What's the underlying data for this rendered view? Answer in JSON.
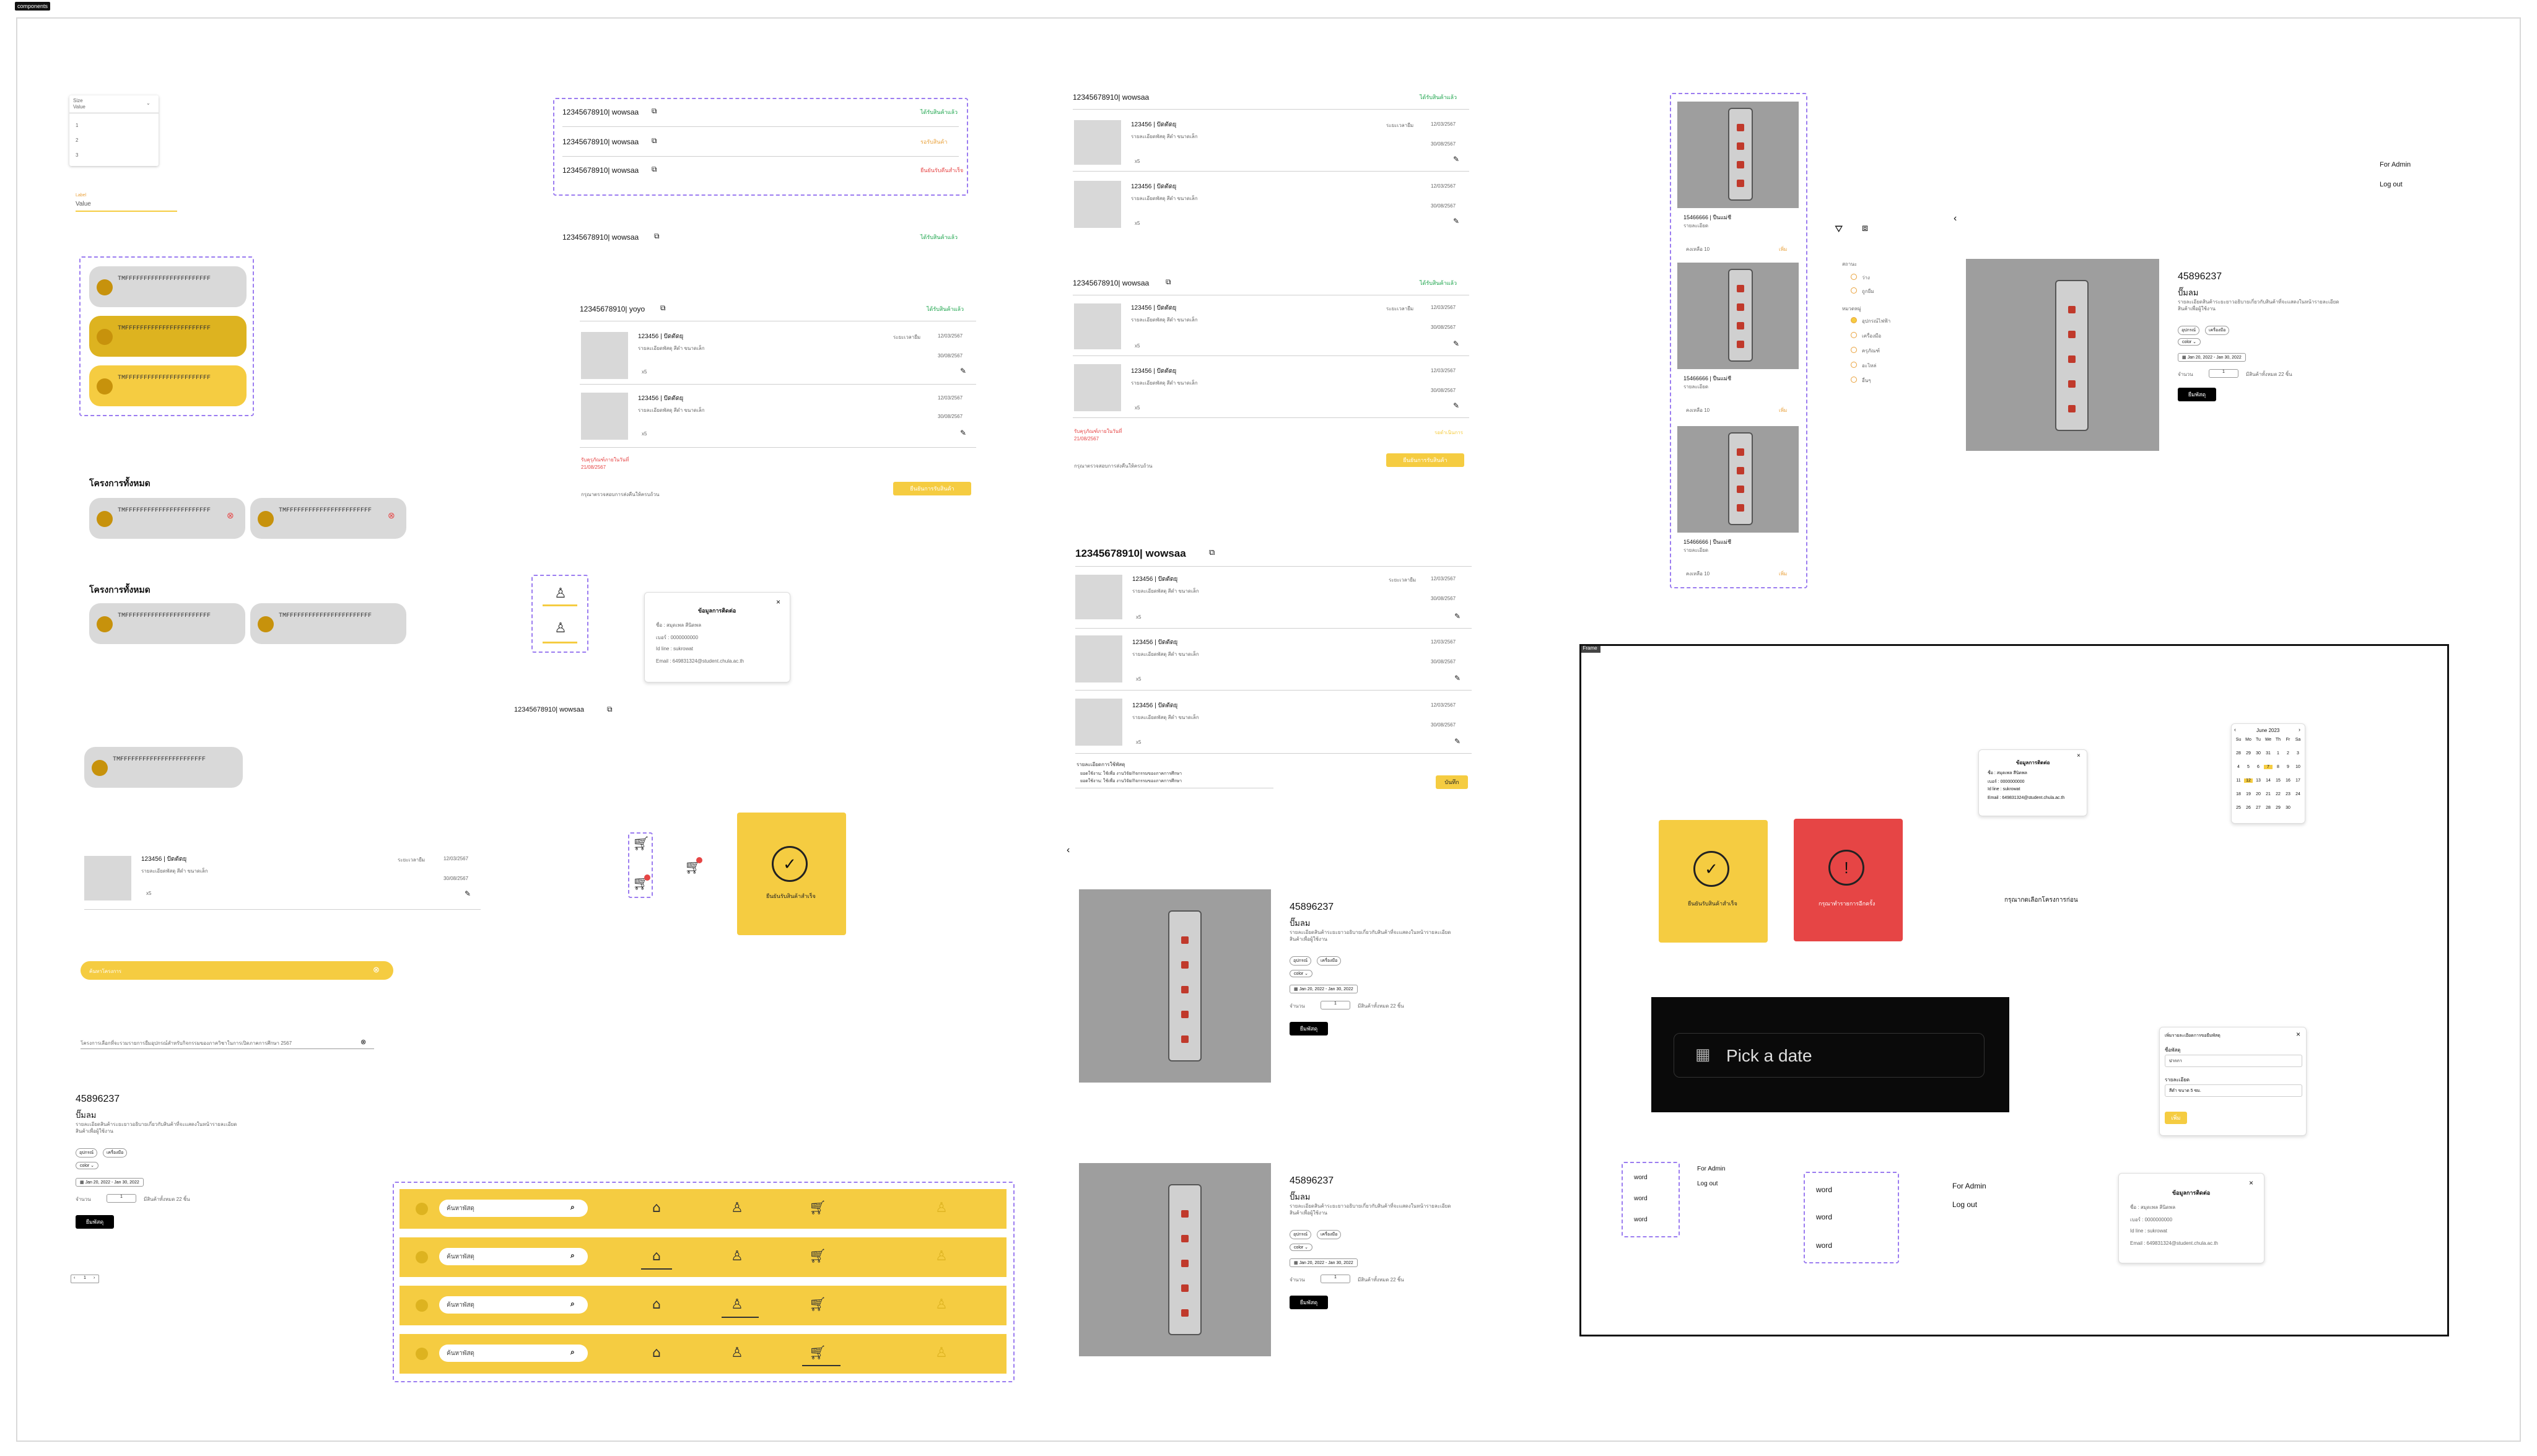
{
  "page": {
    "frame_label": "components",
    "dialog_label": "Frame"
  },
  "dropdown": {
    "label": "Size",
    "selected": "Value",
    "caret": "⌄",
    "options": [
      "1",
      "2",
      "3"
    ]
  },
  "textfield": {
    "label": "Label",
    "value": "Value"
  },
  "pills": {
    "text": "TMFFFFFFFFFFFFFFFFFFFFFFF"
  },
  "section_titles": {
    "all_rooms_1": "โครงการทั้งหมด",
    "all_rooms_2": "โครงการทั้งหมด"
  },
  "orders": {
    "id": "12345678910",
    "user": "wowsaa",
    "user2": "yoyo",
    "status_ready": "ได้รับสินค้าแล้ว",
    "status_waiting": "รอรับสินค้า",
    "status_overdue": "ยืนยันรับคืนสำเร็จ",
    "item_code": "123456 | ปัดตัดยุ",
    "item_desc": "รายละเอียดพัสดุ สีดำ ขนาดเล็ก",
    "borrow_label": "ระยะเวลายืม",
    "date_from": "12/03/2567",
    "date_to": "30/08/2567",
    "qty": "x5",
    "overdue_label": "รับคุรุภัณฑ์ภายในวันที่",
    "overdue_date": "21/08/2567",
    "note": "กรุณาตรวจสอบการส่งคืนให้ครบถ้วน",
    "confirm_btn": "ยืนยันการรับสินค้า",
    "save_btn": "บันทึก",
    "remark_label": "รายละเอียดการใช้พัสดุ",
    "remark_lines": [
      "ยอดใช้งาน: ใช้เพื่อ งานวิจัย/กิจกรรมของภาคการศึกษา",
      "ยอดใช้งาน: ใช้เพื่อ งานวิจัย/กิจกรรมของภาคการศึกษา"
    ],
    "wait_text": "รอดำเนินการ"
  },
  "user_card": {
    "title": "ข้อมูลการติดต่อ",
    "name": "ชื่อ : สมุดเพล สีนิดพล",
    "phone": "เบอร์ : 0000000000",
    "line": "Id line : sukrowat",
    "email": "Email : 649831324@student.chula.ac.th",
    "close": "×"
  },
  "success": {
    "label": "ยืนยันรับสินค้าสำเร็จ"
  },
  "error": {
    "label": "กรุณาทำรายการอีกครั้ง"
  },
  "empty_msg": "กรุณากดเลือกโครงการก่อน",
  "search_pill": {
    "placeholder": "ค้นหาโครงการ"
  },
  "announcement": "โครงการเลือกที่จะรวมรายการยืมอุปกรณ์สำหรับกิจกรรมของภาควิชาในการเปิดภาคการศึกษา 2567",
  "product": {
    "code": "45896237",
    "name": "ปั๊มลม",
    "desc": "รายละเอียดสินค้าระยะยาวอธิบายเกี่ยวกับสินค้าที่จะแสดงในหน้ารายละเอียดสินค้าเพื่อผู้ใช้งาน",
    "tags": [
      "อุปกรณ์",
      "เครื่องมือ"
    ],
    "color": "color ⌄",
    "daterange": "Jan 20, 2022 - Jan 30, 2022",
    "qty_label": "จำนวน",
    "qty": "1",
    "stock": "มีสินค้าทั้งหมด 22 ชิ้น",
    "add_btn": "ยืมพัสดุ"
  },
  "pager": {
    "prev": "‹",
    "page": "1",
    "next": "›"
  },
  "nav": {
    "search_placeholder": "ค้นหาพัสดุ"
  },
  "grid_items": [
    {
      "code": "15466666 | ปืนแม่ชี",
      "sub": "รายละเอียด",
      "qty": "คงเหลือ 10",
      "link": "เพิ่ม"
    },
    {
      "code": "15466666 | ปืนแม่ชี",
      "sub": "รายละเอียด",
      "qty": "คงเหลือ 10",
      "link": "เพิ่ม"
    },
    {
      "code": "15466666 | ปืนแม่ชี",
      "sub": "รายละเอียด",
      "qty": "คงเหลือ 10",
      "link": "เพิ่ม"
    }
  ],
  "filter": {
    "status_title": "สถานะ",
    "status_options": [
      "ว่าง",
      "ถูกยืม"
    ],
    "cat_title": "หมวดหมู่",
    "cat_options": [
      "อุปกรณ์ไฟฟ้า",
      "เครื่องมือ",
      "ครุภัณฑ์",
      "อะไหล่",
      "อื่นๆ"
    ]
  },
  "admin_menu": {
    "item1": "For Admin",
    "item2": "Log out"
  },
  "word_list": [
    "word",
    "word",
    "word"
  ],
  "datepicker": {
    "placeholder": "Pick a date"
  },
  "calendar": {
    "month": "June 2023",
    "weekdays": [
      "Su",
      "Mo",
      "Tu",
      "We",
      "Th",
      "Fr",
      "Sa"
    ],
    "days": [
      "28",
      "29",
      "30",
      "31",
      "1",
      "2",
      "3",
      "4",
      "5",
      "6",
      "7",
      "8",
      "9",
      "10",
      "11",
      "12",
      "13",
      "14",
      "15",
      "16",
      "17",
      "18",
      "19",
      "20",
      "21",
      "22",
      "23",
      "24",
      "25",
      "26",
      "27",
      "28",
      "29",
      "30"
    ]
  },
  "form_modal": {
    "title": "เพิ่มรายละเอียดการขอยืมพัสดุ",
    "field1_label": "ชื่อพัสดุ",
    "field1_value": "ปากกา",
    "field2_label": "รายละเอียด",
    "field2_value": "สีดำ ขนาด 5 ซม.",
    "submit": "เพิ่ม",
    "close": "×"
  },
  "colors": {
    "yellow": "#f5cc41",
    "dark_yellow": "#ddb320",
    "red": "#e64545",
    "green": "#1aa44a",
    "gray": "#d9d9d9"
  }
}
